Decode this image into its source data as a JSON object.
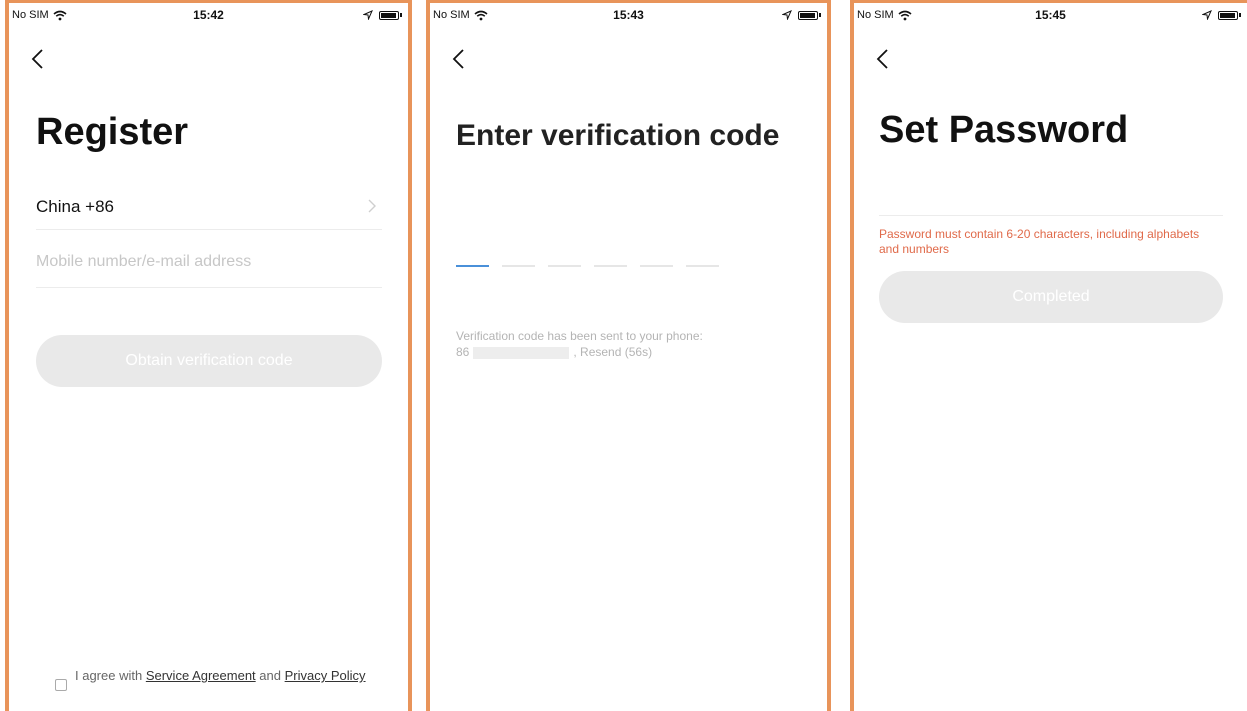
{
  "screens": [
    {
      "status": {
        "carrier": "No SIM",
        "time": "15:42"
      },
      "title": "Register",
      "country": {
        "label": "China +86"
      },
      "mobile": {
        "placeholder": "Mobile number/e-mail address",
        "value": ""
      },
      "primary_button": {
        "label": "Obtain verification code",
        "enabled": false
      },
      "agreement": {
        "prefix": "I agree with",
        "service_link": "Service Agreement",
        "conjunction": "and",
        "privacy_link": "Privacy Policy",
        "checked": false
      }
    },
    {
      "status": {
        "carrier": "No SIM",
        "time": "15:43"
      },
      "title": "Enter verification code",
      "code": {
        "length": 6,
        "active_index": 0
      },
      "hint": {
        "line1": "Verification code has been sent to your phone:",
        "prefix": "86",
        "resend": ", Resend (56s)"
      }
    },
    {
      "status": {
        "carrier": "No SIM",
        "time": "15:45"
      },
      "title": "Set Password",
      "password": {
        "value": ""
      },
      "error": "Password must contain 6-20 characters, including alphabets and numbers",
      "primary_button": {
        "label": "Completed",
        "enabled": false
      }
    }
  ],
  "colors": {
    "frame": "#e8945a",
    "accent": "#4a90d9",
    "error": "#e06a4a",
    "button_disabled": "#e9e9e9"
  },
  "icons": [
    "wifi-icon",
    "location-arrow-icon",
    "battery-icon",
    "back-chevron-icon",
    "chevron-right-icon",
    "checkbox-icon"
  ]
}
